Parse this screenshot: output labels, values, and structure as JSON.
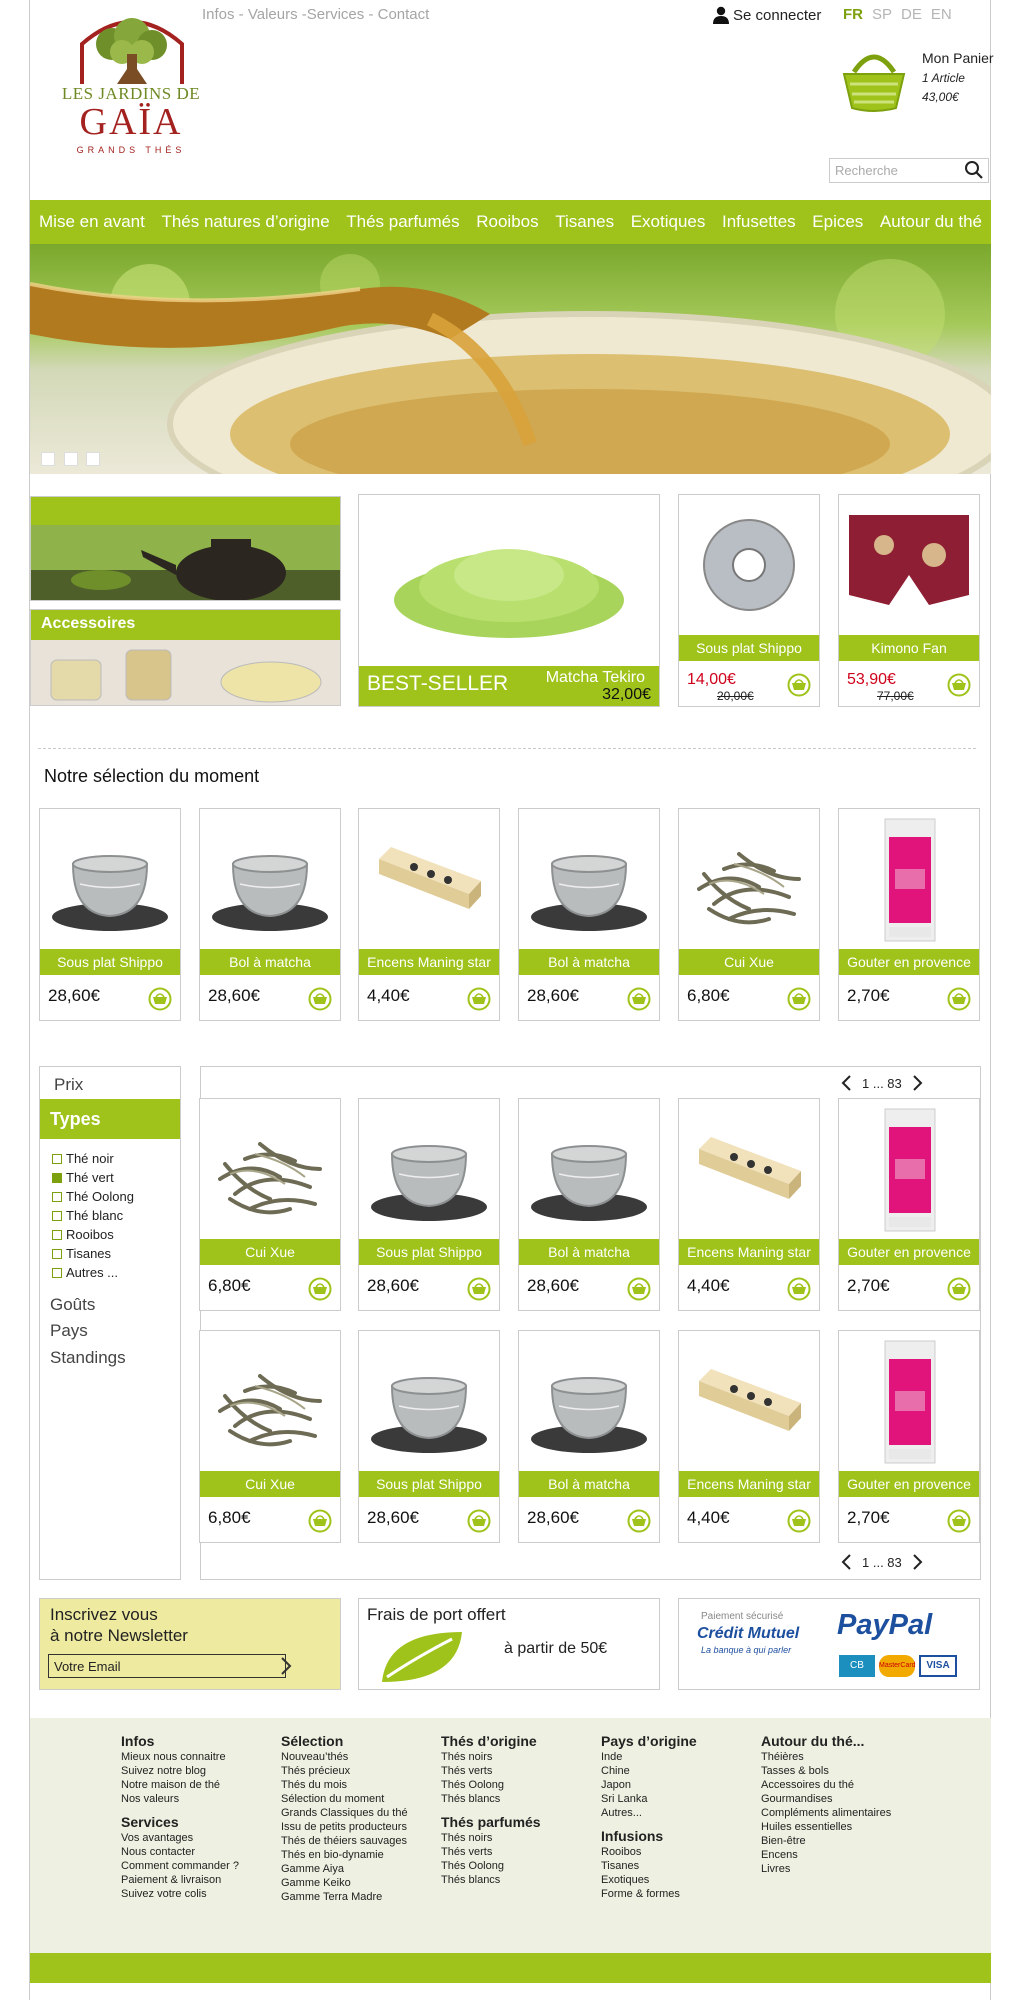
{
  "header": {
    "top_links": "Infos - Valeurs -Services - Contact",
    "login": "Se connecter",
    "languages": [
      "FR",
      "SP",
      "DE",
      "EN"
    ],
    "active_language": "FR",
    "logo_line1": "LES JARDINS DE",
    "logo_line2": "GAÏA",
    "logo_line3": "GRANDS THÉS",
    "cart_title": "Mon Panier",
    "cart_count": "1 Article",
    "cart_total": "43,00€",
    "search_placeholder": "Recherche"
  },
  "nav": [
    "Mise en avant",
    "Thés natures d’origine",
    "Thés parfumés",
    "Rooibos",
    "Tisanes",
    "Exotiques",
    "Infusettes",
    "Epices",
    "Autour du thé"
  ],
  "promo": {
    "accessoires": "Accessoires",
    "bestseller_label": "BEST-SELLER",
    "bestseller_name": "Matcha Tekiro",
    "bestseller_price": "32,00€",
    "p1": {
      "name": "Sous plat Shippo",
      "price": "14,00€",
      "old": "20,00€"
    },
    "p2": {
      "name": "Kimono Fan",
      "price": "53,90€",
      "old": "77,00€"
    }
  },
  "selection": {
    "title": "Notre sélection du moment",
    "items": [
      {
        "name": "Sous plat Shippo",
        "price": "28,60€",
        "img": "bowl"
      },
      {
        "name": "Bol à matcha",
        "price": "28,60€",
        "img": "bowl"
      },
      {
        "name": "Encens Maning star",
        "price": "4,40€",
        "img": "incense"
      },
      {
        "name": "Bol à matcha",
        "price": "28,60€",
        "img": "bowl"
      },
      {
        "name": "Cui Xue",
        "price": "6,80€",
        "img": "leaves"
      },
      {
        "name": "Gouter en provence",
        "price": "2,70€",
        "img": "box"
      }
    ]
  },
  "filters": {
    "prix": "Prix",
    "types": "Types",
    "type_options": [
      {
        "label": "Thé noir",
        "checked": false
      },
      {
        "label": "Thé vert",
        "checked": true
      },
      {
        "label": "Thé Oolong",
        "checked": false
      },
      {
        "label": "Thé blanc",
        "checked": false
      },
      {
        "label": "Rooibos",
        "checked": false
      },
      {
        "label": "Tisanes",
        "checked": false
      },
      {
        "label": "Autres ...",
        "checked": false
      }
    ],
    "gouts": "Goûts",
    "pays": "Pays",
    "standings": "Standings"
  },
  "pagination": "1 ... 83",
  "grid": [
    {
      "name": "Cui Xue",
      "price": "6,80€",
      "img": "leaves"
    },
    {
      "name": "Sous plat Shippo",
      "price": "28,60€",
      "img": "bowl"
    },
    {
      "name": "Bol à matcha",
      "price": "28,60€",
      "img": "bowl"
    },
    {
      "name": "Encens Maning star",
      "price": "4,40€",
      "img": "incense"
    },
    {
      "name": "Gouter en provence",
      "price": "2,70€",
      "img": "box"
    },
    {
      "name": "Cui Xue",
      "price": "6,80€",
      "img": "leaves"
    },
    {
      "name": "Sous plat Shippo",
      "price": "28,60€",
      "img": "bowl"
    },
    {
      "name": "Bol à matcha",
      "price": "28,60€",
      "img": "bowl"
    },
    {
      "name": "Encens Maning star",
      "price": "4,40€",
      "img": "incense"
    },
    {
      "name": "Gouter en provence",
      "price": "2,70€",
      "img": "box"
    }
  ],
  "newsletter": {
    "line1": "Inscrivez vous",
    "line2": "à notre Newsletter",
    "placeholder": "Votre Email"
  },
  "shipping": {
    "title": "Frais de port offert",
    "sub": "à partir de 50€"
  },
  "payment": {
    "title": "Paiement sécurisé",
    "bank": "Crédit Mutuel",
    "bank_sub": "La banque à qui parler",
    "paypal": "PayPal",
    "cards": [
      "CB",
      "MasterCard",
      "VISA"
    ]
  },
  "footer": [
    {
      "blocks": [
        {
          "title": "Infos",
          "items": [
            "Mieux nous connaitre",
            "Suivez notre blog",
            "Notre maison de thé",
            "Nos valeurs"
          ]
        },
        {
          "title": "Services",
          "items": [
            "Vos avantages",
            "Nous contacter",
            "Comment commander ?",
            "Paiement & livraison",
            "Suivez votre colis"
          ]
        }
      ]
    },
    {
      "blocks": [
        {
          "title": "Sélection",
          "items": [
            "Nouveau’thés",
            "Thés précieux",
            "Thés du mois",
            "Sélection du moment",
            "Grands Classiques du thé",
            "Issu de petits producteurs",
            "Thés de théiers sauvages",
            "Thés en bio-dynamie",
            "Gamme Aiya",
            "Gamme Keiko",
            "Gamme Terra Madre"
          ]
        }
      ]
    },
    {
      "blocks": [
        {
          "title": "Thés d’origine",
          "items": [
            "Thés noirs",
            "Thés verts",
            "Thés Oolong",
            "Thés blancs"
          ]
        },
        {
          "title": "Thés parfumés",
          "items": [
            "Thés noirs",
            "Thés verts",
            "Thés Oolong",
            "Thés blancs"
          ]
        }
      ]
    },
    {
      "blocks": [
        {
          "title": "Pays d’origine",
          "items": [
            "Inde",
            "Chine",
            "Japon",
            "Sri Lanka",
            "Autres..."
          ]
        },
        {
          "title": "Infusions",
          "items": [
            "Rooibos",
            "Tisanes",
            "Exotiques",
            "Forme & formes"
          ]
        }
      ]
    },
    {
      "blocks": [
        {
          "title": "Autour du thé...",
          "items": [
            "Théières",
            "Tasses & bols",
            "Accessoires du thé",
            "Gourmandises",
            "Compléments alimentaires",
            "Huiles essentielles",
            "Bien-être",
            "Encens",
            "Livres"
          ]
        }
      ]
    }
  ],
  "colors": {
    "accent": "#9fc31a",
    "accent_dark": "#7da10e",
    "sale": "#d0021b",
    "newsletter_bg": "#eeeaa0",
    "footer_bg": "#eef0e1"
  }
}
